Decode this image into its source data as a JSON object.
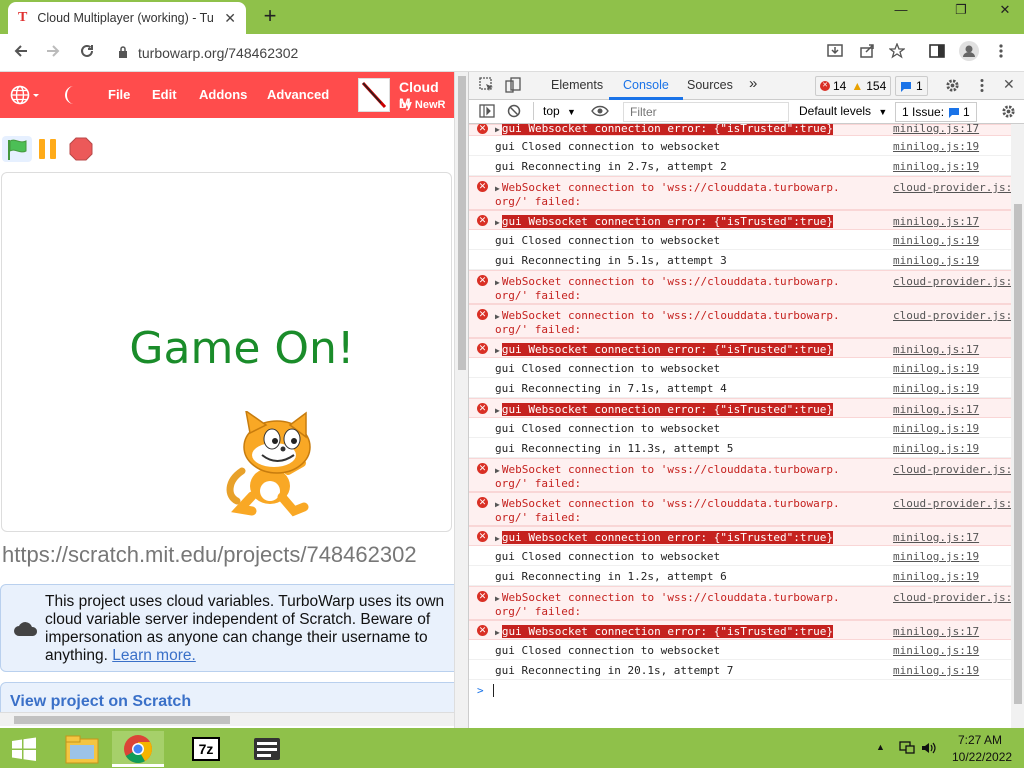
{
  "browser": {
    "tab_title": "Cloud Multiplayer (working) - Tu",
    "tab_icon": "T",
    "tab_close": "✕",
    "new_tab": "+",
    "url": "turbowarp.org/748462302"
  },
  "window_controls": {
    "minimize": "—",
    "restore": "❐",
    "close": "✕"
  },
  "turbowarp": {
    "menu": [
      "File",
      "Edit",
      "Addons",
      "Advanced"
    ],
    "project_title": "Cloud M",
    "project_author": "by NewR",
    "stage_text": "Game On!",
    "project_url": "https://scratch.mit.edu/projects/748462302",
    "cloud_notice": "This project uses cloud variables. TurboWarp uses its own cloud variable server independent of Scratch. Beware of impersonation as anyone can change their username to anything.",
    "learn_more": "Learn more.",
    "view_on_scratch": "View project on Scratch"
  },
  "devtools": {
    "tabs": [
      "Elements",
      "Console",
      "Sources"
    ],
    "more_tabs": "»",
    "error_count": "14",
    "warning_count": "154",
    "message_count": "1",
    "context": "top",
    "filter_placeholder": "Filter",
    "levels": "Default levels",
    "issues": "1 Issue:",
    "issues_count": "1",
    "prompt": ">"
  },
  "console_rows": [
    {
      "type": "err-hl",
      "text": "gui Websocket connection error: {\"isTrusted\":true}",
      "src": "minilog.js:17",
      "partial": true
    },
    {
      "type": "log",
      "text": "gui Closed connection to websocket",
      "src": "minilog.js:19"
    },
    {
      "type": "log",
      "text": "gui Reconnecting in 2.7s, attempt 2",
      "src": "minilog.js:19"
    },
    {
      "type": "err-ws",
      "text": "WebSocket connection to 'wss://clouddata.turbowarp.",
      "text2": "org/' failed:",
      "src": "cloud-provider.js:54"
    },
    {
      "type": "err-hl",
      "text": "gui Websocket connection error: {\"isTrusted\":true}",
      "src": "minilog.js:17"
    },
    {
      "type": "log",
      "text": "gui Closed connection to websocket",
      "src": "minilog.js:19"
    },
    {
      "type": "log",
      "text": "gui Reconnecting in 5.1s, attempt 3",
      "src": "minilog.js:19"
    },
    {
      "type": "err-ws",
      "text": "WebSocket connection to 'wss://clouddata.turbowarp.",
      "text2": "org/' failed:",
      "src": "cloud-provider.js:54"
    },
    {
      "type": "err-ws",
      "text": "WebSocket connection to 'wss://clouddata.turbowarp.",
      "text2": "org/' failed:",
      "src": "cloud-provider.js:54"
    },
    {
      "type": "err-hl",
      "text": "gui Websocket connection error: {\"isTrusted\":true}",
      "src": "minilog.js:17"
    },
    {
      "type": "log",
      "text": "gui Closed connection to websocket",
      "src": "minilog.js:19"
    },
    {
      "type": "log",
      "text": "gui Reconnecting in 7.1s, attempt 4",
      "src": "minilog.js:19"
    },
    {
      "type": "err-hl",
      "text": "gui Websocket connection error: {\"isTrusted\":true}",
      "src": "minilog.js:17"
    },
    {
      "type": "log",
      "text": "gui Closed connection to websocket",
      "src": "minilog.js:19"
    },
    {
      "type": "log",
      "text": "gui Reconnecting in 11.3s, attempt 5",
      "src": "minilog.js:19"
    },
    {
      "type": "err-ws",
      "text": "WebSocket connection to 'wss://clouddata.turbowarp.",
      "text2": "org/' failed:",
      "src": "cloud-provider.js:54"
    },
    {
      "type": "err-ws",
      "text": "WebSocket connection to 'wss://clouddata.turbowarp.",
      "text2": "org/' failed:",
      "src": "cloud-provider.js:54"
    },
    {
      "type": "err-hl",
      "text": "gui Websocket connection error: {\"isTrusted\":true}",
      "src": "minilog.js:17"
    },
    {
      "type": "log",
      "text": "gui Closed connection to websocket",
      "src": "minilog.js:19"
    },
    {
      "type": "log",
      "text": "gui Reconnecting in 1.2s, attempt 6",
      "src": "minilog.js:19"
    },
    {
      "type": "err-ws",
      "text": "WebSocket connection to 'wss://clouddata.turbowarp.",
      "text2": "org/' failed:",
      "src": "cloud-provider.js:54"
    },
    {
      "type": "err-hl",
      "text": "gui Websocket connection error: {\"isTrusted\":true}",
      "src": "minilog.js:17"
    },
    {
      "type": "log",
      "text": "gui Closed connection to websocket",
      "src": "minilog.js:19"
    },
    {
      "type": "log",
      "text": "gui Reconnecting in 20.1s, attempt 7",
      "src": "minilog.js:19"
    }
  ],
  "taskbar": {
    "clock_time": "7:27 AM",
    "clock_date": "10/22/2022",
    "sevenzip_label": "7z"
  },
  "colors": {
    "chrome_frame": "#8fc14a",
    "turbowarp_menu": "#ff4c4c",
    "stage_text": "#1a8c2a",
    "console_error": "#c5221f"
  }
}
